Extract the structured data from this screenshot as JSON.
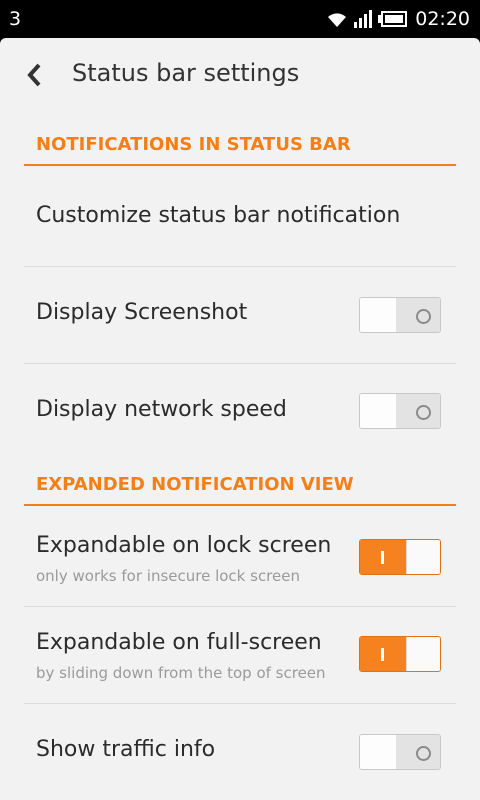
{
  "status_bar": {
    "left_text": "3",
    "time": "02:20",
    "icons": [
      "wifi-icon",
      "signal-icon",
      "battery-icon"
    ]
  },
  "header": {
    "title": "Status bar settings",
    "back_icon": "chevron-left-icon"
  },
  "sections": [
    {
      "title": "NOTIFICATIONS IN STATUS BAR"
    },
    {
      "title": "EXPANDED NOTIFICATION VIEW"
    }
  ],
  "rows": [
    {
      "label": "Customize status bar notification"
    },
    {
      "label": "Display Screenshot",
      "toggle": false
    },
    {
      "label": "Display network speed",
      "toggle": false
    },
    {
      "label": "Expandable on lock screen",
      "sublabel": "only works for insecure lock screen",
      "toggle": true
    },
    {
      "label": "Expandable on full-screen",
      "sublabel": "by sliding down from the top of screen",
      "toggle": true
    },
    {
      "label": "Show traffic info",
      "toggle": false
    }
  ],
  "colors": {
    "accent": "#f57f17",
    "background": "#f2f2f2",
    "status_bar": "#000000"
  }
}
